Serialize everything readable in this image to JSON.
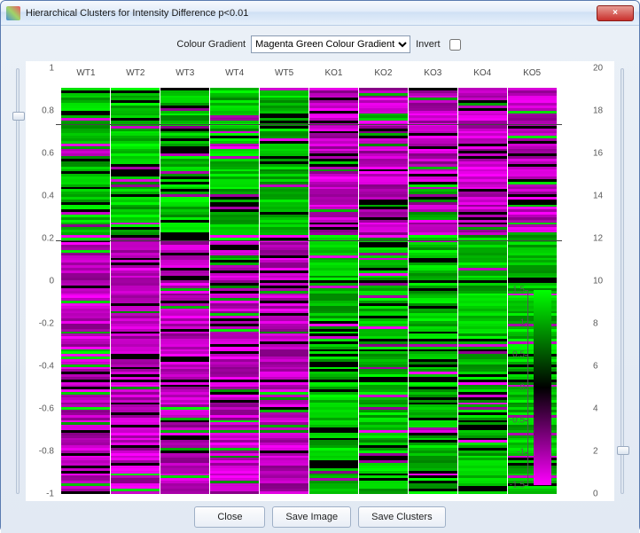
{
  "window": {
    "title": "Hierarchical Clusters for Intensity Difference p<0.01",
    "close_icon": "×"
  },
  "toolbar": {
    "gradient_label": "Colour Gradient",
    "gradient_selected": "Magenta Green Colour Gradient",
    "gradient_options": [
      "Magenta Green Colour Gradient"
    ],
    "invert_label": "Invert",
    "invert_checked": false
  },
  "sliders": {
    "left": {
      "min": -1.0,
      "max": 1.0,
      "value": 0.78
    },
    "right": {
      "min": 0,
      "max": 20,
      "value": 2
    }
  },
  "chart_data": {
    "type": "heatmap",
    "columns": [
      "WT1",
      "WT2",
      "WT3",
      "WT4",
      "WT5",
      "KO1",
      "KO2",
      "KO3",
      "KO4",
      "KO5"
    ],
    "y_axis_left": {
      "min": -1.0,
      "max": 1.0,
      "ticks": [
        1.0,
        0.8,
        0.6,
        0.4,
        0.2,
        -0.0,
        -0.2,
        -0.4,
        -0.6,
        -0.8,
        -1.0
      ]
    },
    "y_axis_right": {
      "min": 0,
      "max": 20,
      "ticks": [
        20,
        18,
        16,
        14,
        12,
        10,
        8,
        6,
        4,
        2,
        0
      ]
    },
    "cluster_breaks": [
      0.82,
      0.25
    ],
    "legend": {
      "min": -1.5,
      "max": 1.5,
      "ticks": [
        1.5,
        1,
        0.5,
        0,
        -0.5,
        -1,
        -1.5
      ]
    },
    "cluster_pattern": {
      "top_fraction": 0.36,
      "wt_top": "green",
      "ko_top": "magenta",
      "wt_bottom": "magenta",
      "ko_bottom": "green"
    }
  },
  "buttons": {
    "close": "Close",
    "save_image": "Save Image",
    "save_clusters": "Save Clusters"
  }
}
